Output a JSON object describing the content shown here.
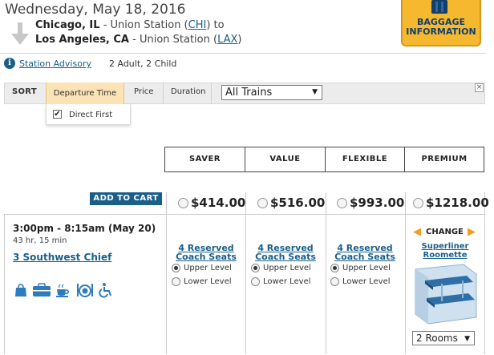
{
  "header": {
    "date": "Wednesday, May 18, 2016",
    "origin_city": "Chicago, IL",
    "origin_station": " - Union Station (",
    "origin_code": "CHI",
    "origin_suffix": ") to",
    "dest_city": "Los Angeles, CA",
    "dest_station": " - Union Station (",
    "dest_code": "LAX",
    "dest_suffix": ")",
    "baggage_line1": "BAGGAGE",
    "baggage_line2": "INFORMATION"
  },
  "info": {
    "advisory": "Station Advisory",
    "passengers": "2 Adult, 2 Child"
  },
  "sort": {
    "label": "SORT",
    "options": [
      "Departure Time",
      "Price",
      "Duration"
    ],
    "active": "Departure Time",
    "trains_filter": "All Trains",
    "direct_first": "Direct First",
    "direct_first_checked": true
  },
  "fares": {
    "columns": [
      "SAVER",
      "VALUE",
      "FLEXIBLE",
      "PREMIUM"
    ],
    "add_to_cart": "ADD TO CART",
    "prices": [
      "$414.00",
      "$516.00",
      "$993.00",
      "$1218.00"
    ]
  },
  "train": {
    "times": "3:00pm - 8:15am (May 20)",
    "duration": "43 hr, 15 min",
    "name": "3 Southwest Chief",
    "amenities": [
      "checked-baggage-icon",
      "quiet-car-icon",
      "cafe-icon",
      "dining-icon",
      "accessible-icon"
    ]
  },
  "seating": {
    "coach_link_line1": "4 Reserved",
    "coach_link_line2": "Coach Seats",
    "upper": "Upper Level",
    "lower": "Lower Level",
    "change": "CHANGE",
    "roomette_line1": "Superliner",
    "roomette_line2": "Roomette",
    "rooms": "2 Rooms"
  },
  "colors": {
    "link": "#1a5f8a",
    "baggage_bg": "#f5b82e",
    "sort_active_bg": "#fbe3b5",
    "chevron": "#f0a020"
  }
}
